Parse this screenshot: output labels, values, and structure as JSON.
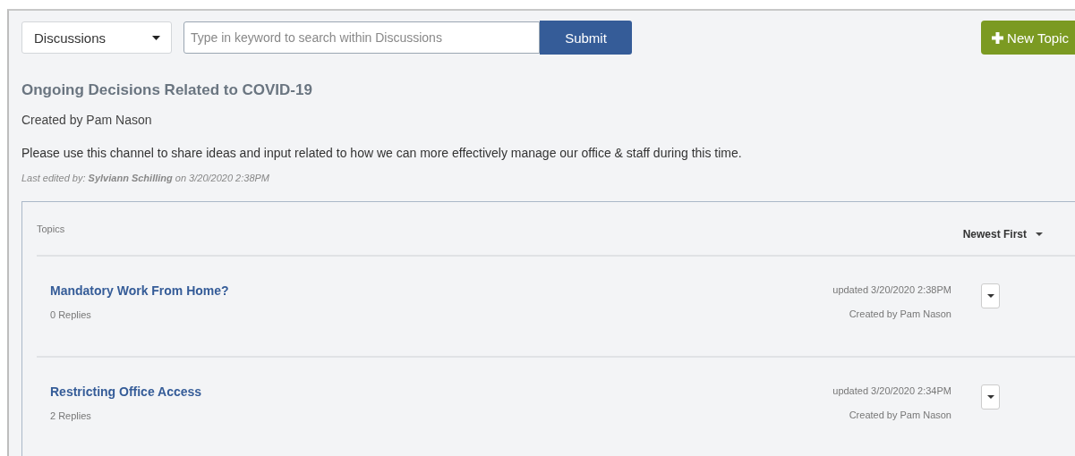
{
  "scope_dropdown": {
    "value": "Discussions"
  },
  "search": {
    "placeholder": "Type in keyword to search within Discussions"
  },
  "submit_button": "Submit",
  "new_topic_button": "New Topic",
  "channel": {
    "title": "Ongoing Decisions Related to COVID-19",
    "created_by": "Created by Pam Nason",
    "description": "Please use this channel to share ideas and input related to how we can more effectively manage our office & staff during this time.",
    "last_edited": "Last edited by: **Sylviann Schilling** on 3/20/2020 2:38PM"
  },
  "topics": {
    "heading": "Topics",
    "sort": "Newest First",
    "items": [
      {
        "title": "Mandatory Work From Home?",
        "replies": "0 Replies",
        "updated": "updated 3/20/2020 2:38PM",
        "created_by": "Created by Pam Nason"
      },
      {
        "title": "Restricting Office Access",
        "replies": "2 Replies",
        "updated": "updated 3/20/2020 2:34PM",
        "created_by": "Created by Pam Nason"
      }
    ]
  }
}
